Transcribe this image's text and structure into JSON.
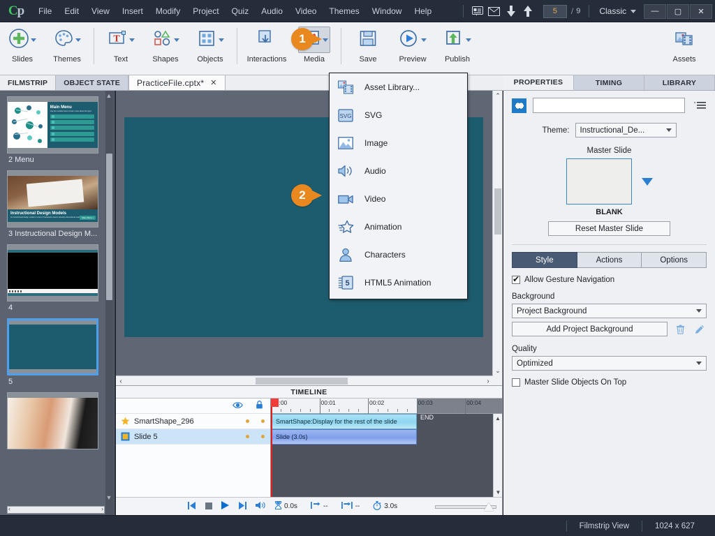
{
  "app": {
    "logo": "Cp",
    "menus": [
      "File",
      "Edit",
      "View",
      "Insert",
      "Modify",
      "Project",
      "Quiz",
      "Audio",
      "Video",
      "Themes",
      "Window",
      "Help"
    ],
    "slide_current": "5",
    "slide_sep": "/",
    "slide_total": "9",
    "workspace": "Classic",
    "window_minimize": "—",
    "window_maximize": "▢",
    "window_close": "✕"
  },
  "ribbon": {
    "groups": [
      {
        "items": [
          {
            "label": "Slides",
            "icon": "plus-circle-icon",
            "caret": true
          },
          {
            "label": "Themes",
            "icon": "palette-icon",
            "caret": true
          }
        ]
      },
      {
        "items": [
          {
            "label": "Text",
            "icon": "text-box-icon",
            "caret": true
          },
          {
            "label": "Shapes",
            "icon": "shapes-icon",
            "caret": true
          },
          {
            "label": "Objects",
            "icon": "objects-grid-icon",
            "caret": true
          }
        ]
      },
      {
        "items": [
          {
            "label": "Interactions",
            "icon": "interactions-icon",
            "caret": false
          },
          {
            "label": "Media",
            "icon": "media-image-icon",
            "caret": true,
            "active": true
          }
        ]
      },
      {
        "items": [
          {
            "label": "Save",
            "icon": "floppy-disk-icon",
            "caret": false
          },
          {
            "label": "Preview",
            "icon": "play-circle-icon",
            "caret": true
          },
          {
            "label": "Publish",
            "icon": "publish-upload-icon",
            "caret": true
          }
        ]
      }
    ],
    "assets": {
      "label": "Assets",
      "icon": "assets-icon"
    }
  },
  "tabs": {
    "filmstrip": "FILMSTRIP",
    "object_state": "OBJECT STATE",
    "document": "PracticeFile.cptx*",
    "close_glyph": "✕"
  },
  "media_menu": {
    "items": [
      {
        "label": "Asset Library...",
        "icon": "asset-library-icon"
      },
      {
        "label": "SVG",
        "icon": "svg-icon"
      },
      {
        "label": "Image",
        "icon": "image-icon"
      },
      {
        "label": "Audio",
        "icon": "audio-speaker-icon"
      },
      {
        "label": "Video",
        "icon": "video-camera-icon"
      },
      {
        "label": "Animation",
        "icon": "animation-star-icon"
      },
      {
        "label": "Characters",
        "icon": "characters-person-icon"
      },
      {
        "label": "HTML5 Animation",
        "icon": "html5-icon"
      }
    ]
  },
  "filmstrip": {
    "slides": [
      {
        "label": "2 Menu",
        "art": "menu",
        "selected": false
      },
      {
        "label": "3 Instructional Design M...",
        "art": "idm",
        "selected": false
      },
      {
        "label": "4",
        "art": "black",
        "selected": false
      },
      {
        "label": "5",
        "art": "teal",
        "selected": true
      },
      {
        "label": "",
        "art": "people",
        "selected": false
      }
    ]
  },
  "timeline": {
    "title": "TIMELINE",
    "header_icons": {
      "eye": "eye-icon",
      "lock": "lock-icon"
    },
    "rows": [
      {
        "name": "SmartShape_296",
        "icon": "star-icon",
        "selected": false,
        "bar_label": "SmartShape:Display for the rest of the slide",
        "bar_start_s": 0,
        "bar_end_s": 3.0
      },
      {
        "name": "Slide 5",
        "icon": "slide-square-icon",
        "selected": true,
        "bar_label": "Slide (3.0s)",
        "bar_start_s": 0,
        "bar_end_s": 3.0
      }
    ],
    "end_label": "END",
    "ruler_labels": [
      "00:00",
      "00:01",
      "00:02",
      "00:03",
      "00:04"
    ],
    "transport": [
      "skip-start-icon",
      "stop-icon",
      "play-icon",
      "skip-end-icon",
      "volume-icon"
    ],
    "metrics": [
      {
        "icon": "hourglass-icon",
        "value": "0.0s"
      },
      {
        "icon": "start-marker-icon",
        "value": "--"
      },
      {
        "icon": "end-marker-icon",
        "value": "--"
      },
      {
        "icon": "stopwatch-icon",
        "value": "3.0s"
      }
    ]
  },
  "properties": {
    "tabs": [
      {
        "label": "PROPERTIES",
        "selected": true
      },
      {
        "label": "TIMING",
        "selected": false
      },
      {
        "label": "LIBRARY",
        "selected": false
      }
    ],
    "name_value": "",
    "name_placeholder": "",
    "theme_label": "Theme:",
    "theme_value": "Instructional_De...",
    "master_slide_title": "Master Slide",
    "master_slide_name": "BLANK",
    "reset_master_slide": "Reset Master Slide",
    "segments": [
      {
        "label": "Style",
        "selected": true
      },
      {
        "label": "Actions",
        "selected": false
      },
      {
        "label": "Options",
        "selected": false
      }
    ],
    "allow_gesture_navigation": {
      "label": "Allow Gesture Navigation",
      "checked": true
    },
    "background_label": "Background",
    "background_value": "Project Background",
    "add_project_background": "Add Project Background",
    "quality_label": "Quality",
    "quality_value": "Optimized",
    "master_objects_on_top": {
      "label": "Master Slide Objects On Top",
      "checked": false
    },
    "delete_icon": "trash-icon",
    "edit_icon": "pencil-icon",
    "menu_icon": "panel-menu-icon",
    "object_swatch_icon": "slide-object-icon"
  },
  "statusbar": {
    "view_mode": "Filmstrip View",
    "dimensions": "1024 x 627"
  },
  "callouts": [
    {
      "number": "1",
      "target": "media-ribbon-button"
    },
    {
      "number": "2",
      "target": "media-menu-video-item"
    }
  ],
  "colors": {
    "accent_orange": "#e8881f",
    "chrome_dark": "#262d3a",
    "ribbon_bg": "#f0f1f4",
    "slide_teal": "#1d5c6e",
    "selection_blue": "#4ea0ef",
    "icon_blue": "#4a7ebb"
  }
}
